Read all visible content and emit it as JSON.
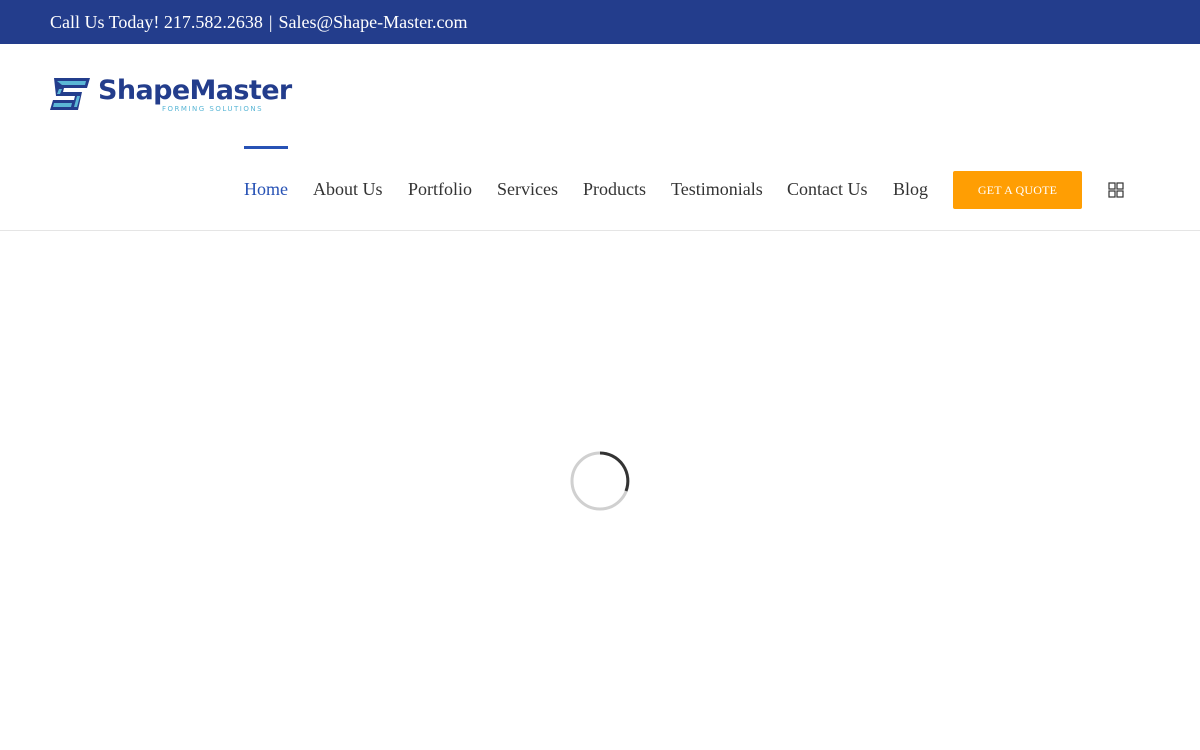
{
  "topbar": {
    "call_text": "Call Us Today! 217.582.2638",
    "separator": "|",
    "email": "Sales@Shape-Master.com",
    "background": "#233d8c"
  },
  "logo": {
    "name": "ShapeMaster",
    "tagline": "FORMING SOLUTIONS",
    "icon": "shapemaster-logo-mark"
  },
  "nav": {
    "items": [
      {
        "label": "Home",
        "active": true
      },
      {
        "label": "About Us"
      },
      {
        "label": "Portfolio"
      },
      {
        "label": "Services"
      },
      {
        "label": "Products"
      },
      {
        "label": "Testimonials"
      },
      {
        "label": "Contact Us"
      },
      {
        "label": "Blog"
      }
    ],
    "active_color": "#2752b5"
  },
  "cta": {
    "label": "GET A QUOTE",
    "color": "#ff9e03"
  },
  "icons": {
    "menu": "grid-menu-icon",
    "loading": "loading-spinner-icon"
  }
}
